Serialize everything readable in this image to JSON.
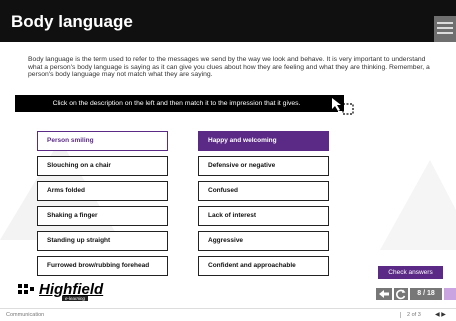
{
  "header": {
    "title": "Body language",
    "menu_icon": "hamburger-menu-icon"
  },
  "intro": "Body language is the term used to refer to the messages we send by the way we look and behave. It is very important to understand what a person's body language is saying as it can give you clues about how they are feeling and what they are thinking. Remember, a person's body language may not match what they are saying.",
  "instruction": "Click on the description on the left and then match it to the impression that it gives.",
  "descriptions": [
    "Person smiling",
    "Slouching on a chair",
    "Arms folded",
    "Shaking a finger",
    "Standing up straight",
    "Furrowed brow/rubbing forehead"
  ],
  "impressions": [
    "Happy and welcoming",
    "Defensive or negative",
    "Confused",
    "Lack of interest",
    "Aggressive",
    "Confident and approachable"
  ],
  "selected_description_index": 0,
  "selected_impression_index": 0,
  "check_answers_label": "Check answers",
  "logo": {
    "name": "Highfield",
    "tagline": "e-learning"
  },
  "nav": {
    "page_indicator": "8 / 18"
  },
  "footer": {
    "section": "Communication",
    "page_of": "2 of 3"
  },
  "colors": {
    "accent": "#5b2a86",
    "header": "#101010",
    "nav_grey": "#777777"
  }
}
